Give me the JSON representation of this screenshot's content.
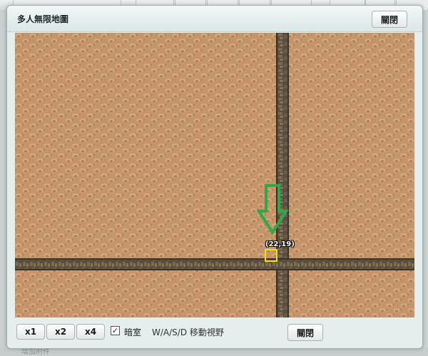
{
  "background_app": {
    "footer_text": "增加附件"
  },
  "dialog": {
    "title": "多人無限地圖",
    "close_label": "關閉",
    "bottom_close_label": "關閉"
  },
  "map": {
    "player_coord_label": "(22,19)",
    "marker_color": "#f0e000",
    "arrow_color": "#2ea84a",
    "terrain": "sand-with-stone-roads"
  },
  "controls": {
    "zoom_x1": "x1",
    "zoom_x2": "x2",
    "zoom_x4": "x4",
    "darkroom_checked": true,
    "darkroom_check_glyph": "✓",
    "darkroom_label": "暗室",
    "move_hint": "W/A/S/D 移動視野"
  }
}
